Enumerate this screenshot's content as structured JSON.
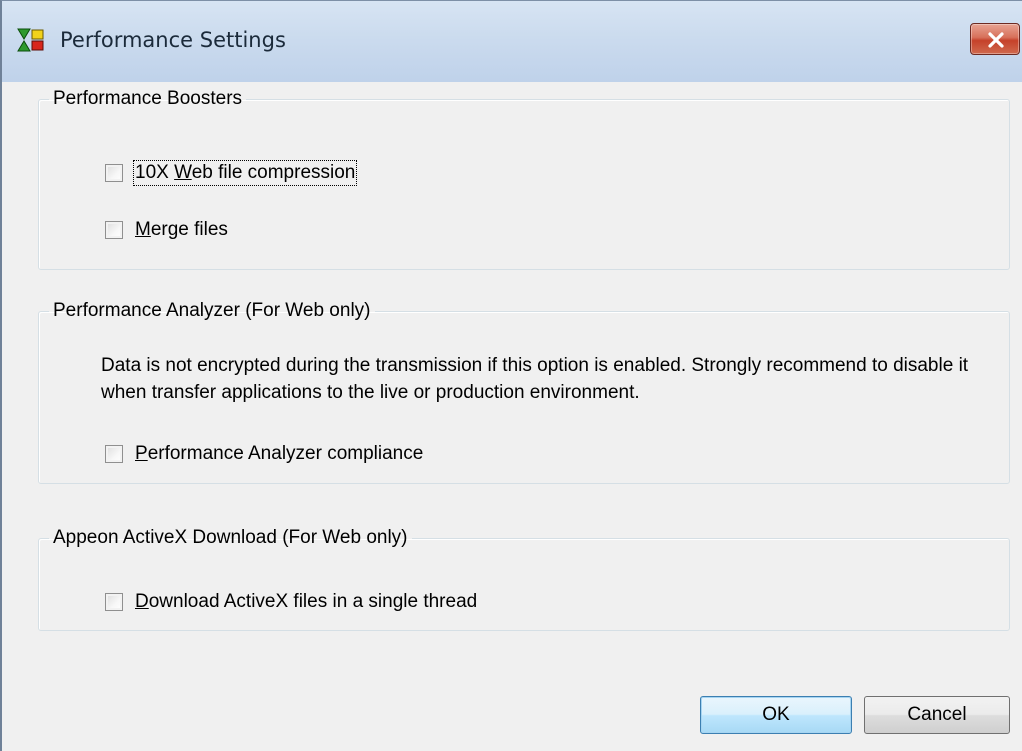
{
  "window": {
    "title": "Performance Settings"
  },
  "boosters": {
    "legend": "Performance Boosters",
    "compression": {
      "label": "10X Web file compression",
      "mnemonic": "W",
      "checked": false
    },
    "merge": {
      "label": "Merge files",
      "mnemonic": "M",
      "checked": false
    }
  },
  "analyzer": {
    "legend": "Performance Analyzer (For Web only)",
    "notice": "Data is not encrypted during the transmission if this option is enabled. Strongly recommend to disable it when transfer applications to the live or production environment.",
    "compliance": {
      "label": "Performance Analyzer compliance",
      "mnemonic": "P",
      "checked": false
    }
  },
  "activex": {
    "legend": "Appeon ActiveX Download (For Web only)",
    "single_thread": {
      "label": "Download ActiveX files in a single thread",
      "mnemonic": "D",
      "checked": false
    }
  },
  "buttons": {
    "ok": "OK",
    "cancel": "Cancel"
  },
  "icons": {
    "app": "appeon-app-icon",
    "close": "close-icon"
  },
  "colors": {
    "title_bar": "#cbdbee",
    "close_button": "#c5412a",
    "dialog_bg": "#f0f0f0",
    "default_button_border": "#3c7fb1"
  }
}
